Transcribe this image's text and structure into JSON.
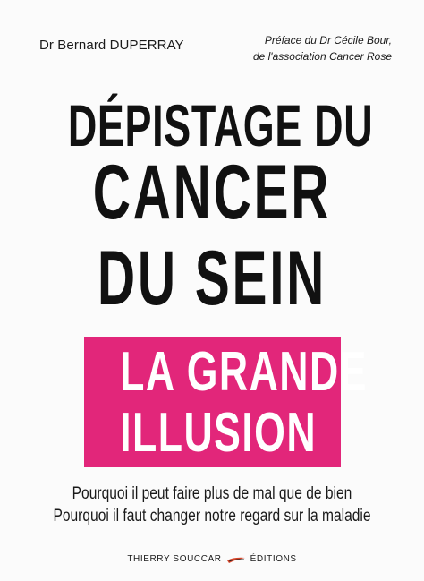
{
  "cover": {
    "author": "Dr Bernard DUPERRAY",
    "preface": {
      "line1": "Préface du Dr Cécile Bour,",
      "line2": "de l'association Cancer Rose"
    },
    "title": {
      "line1": "DÉPISTAGE DU",
      "line2": "CANCER",
      "line3": "DU SEIN"
    },
    "highlight": {
      "line1": "LA GRANDE",
      "line2": "ILLUSION",
      "background_color": "#e2267a",
      "text_color": "#ffffff"
    },
    "subtitle": {
      "line1": "Pourquoi il peut faire plus de mal que de bien",
      "line2": "Pourquoi il faut changer notre regard sur la maladie"
    },
    "publisher": {
      "left": "THIERRY SOUCCAR",
      "right": "ÉDITIONS",
      "logo_icon": "swoosh-logo-icon"
    }
  }
}
